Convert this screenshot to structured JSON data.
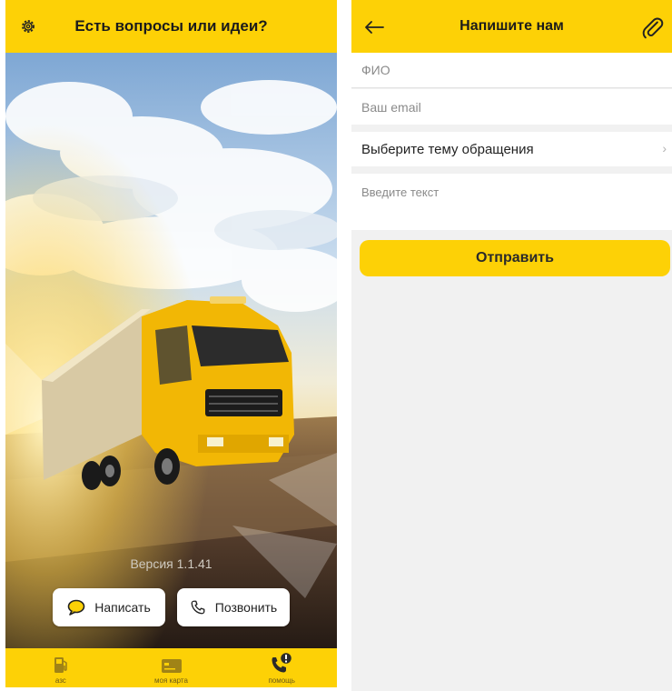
{
  "left_screen": {
    "header": {
      "title": "Есть вопросы или идеи?",
      "settings_icon": "gear-icon"
    },
    "version_text": "Версия 1.1.41",
    "actions": {
      "write_label": "Написать",
      "write_icon": "chat-bubble-icon",
      "call_label": "Позвонить",
      "call_icon": "phone-icon"
    },
    "tabbar": [
      {
        "label": "азс",
        "icon": "fuel-pump-icon"
      },
      {
        "label": "моя карта",
        "icon": "card-icon"
      },
      {
        "label": "помощь",
        "icon": "help-phone-icon",
        "active": true
      }
    ]
  },
  "right_screen": {
    "header": {
      "title": "Напишите нам",
      "back_icon": "arrow-left-icon",
      "attach_icon": "paperclip-icon"
    },
    "form": {
      "fio_placeholder": "ФИО",
      "email_placeholder": "Ваш email",
      "topic_label": "Выберите тему обращения",
      "text_placeholder": "Введите текст"
    },
    "send_label": "Отправить"
  },
  "colors": {
    "accent": "#fdd106",
    "background": "#f1f1f1"
  }
}
